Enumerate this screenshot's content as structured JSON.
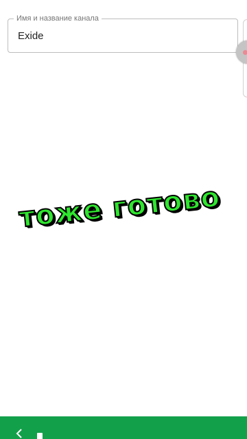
{
  "form": {
    "channel_name_field": {
      "label": "Имя и название канала",
      "value": "Exide"
    }
  },
  "overlay": {
    "caption": "тоже готово"
  },
  "icons": {
    "bottom_left": "back-arrow-icon",
    "edge_handle": "floating-assistant-icon"
  },
  "colors": {
    "bottom_bar": "#13a04b",
    "caption_fill": "#2fe62f",
    "caption_outline": "#000000"
  }
}
